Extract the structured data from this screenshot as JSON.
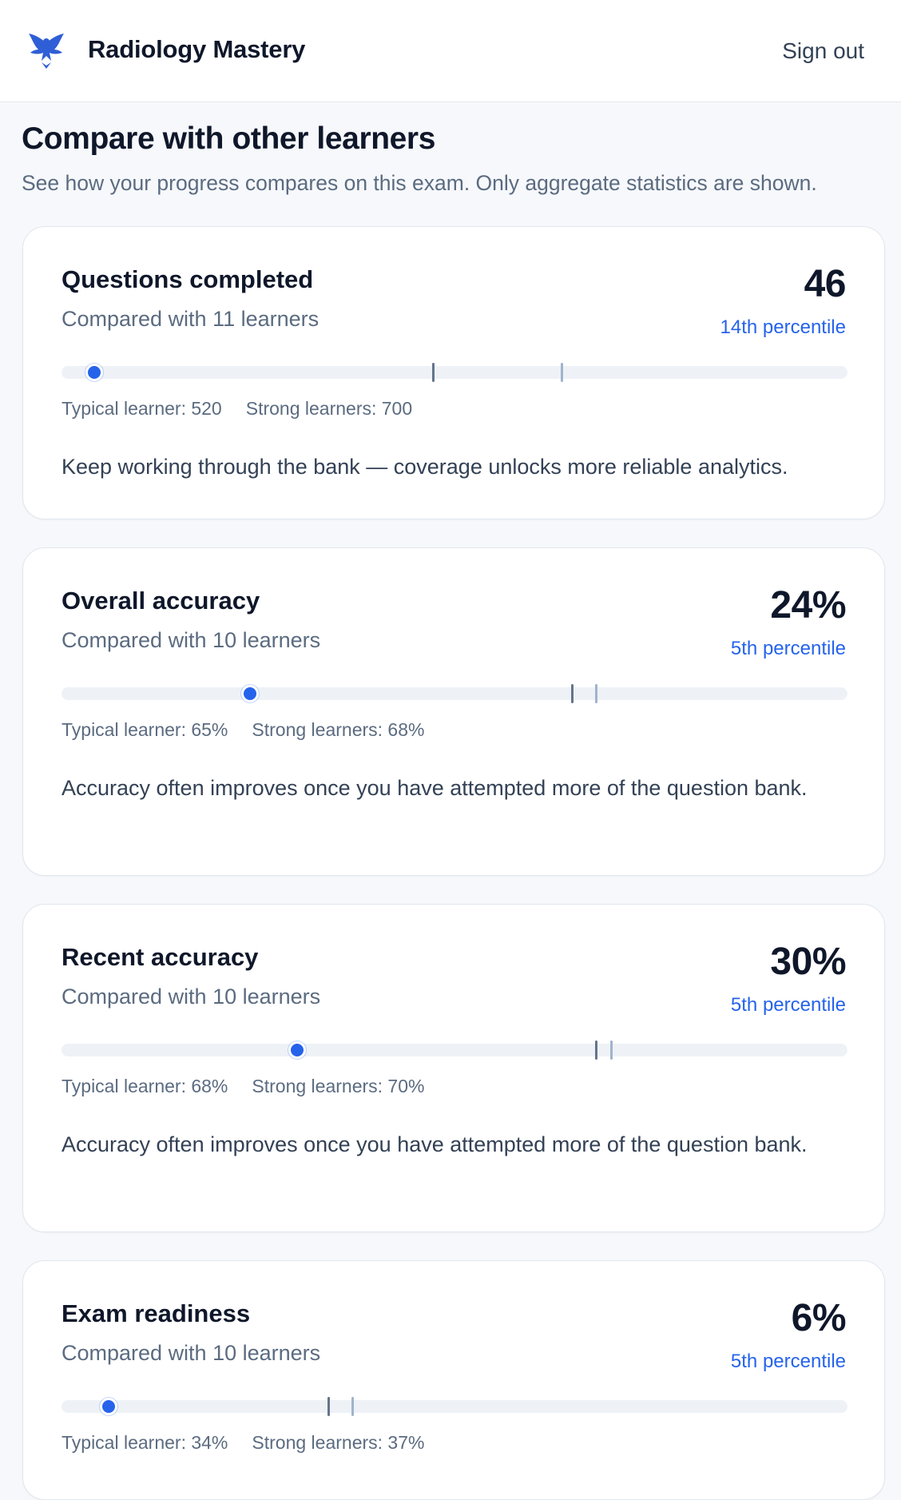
{
  "app": {
    "title": "Radiology Mastery",
    "sign_out": "Sign out",
    "logo_icon": "eagle-logo-icon",
    "accent": "#2563eb"
  },
  "page": {
    "title": "Compare with other learners",
    "subtitle": "See how your progress compares on this exam. Only aggregate statistics are shown."
  },
  "cards": [
    {
      "title": "Questions completed",
      "compared": "Compared with 11 learners",
      "value": "46",
      "percentile": "14th percentile",
      "typical_label": "Typical learner: 520",
      "strong_label": "Strong learners: 700",
      "message": "Keep working through the bank — coverage unlocks more reliable analytics.",
      "scale_max": 1100,
      "you": 46,
      "typical": 520,
      "strong": 700
    },
    {
      "title": "Overall accuracy",
      "compared": "Compared with 10 learners",
      "value": "24%",
      "percentile": "5th percentile",
      "typical_label": "Typical learner: 65%",
      "strong_label": "Strong learners: 68%",
      "message": "Accuracy often improves once you have attempted more of the question bank.",
      "scale_max": 100,
      "you": 24,
      "typical": 65,
      "strong": 68
    },
    {
      "title": "Recent accuracy",
      "compared": "Compared with 10 learners",
      "value": "30%",
      "percentile": "5th percentile",
      "typical_label": "Typical learner: 68%",
      "strong_label": "Strong learners: 70%",
      "message": "Accuracy often improves once you have attempted more of the question bank.",
      "scale_max": 100,
      "you": 30,
      "typical": 68,
      "strong": 70
    },
    {
      "title": "Exam readiness",
      "compared": "Compared with 10 learners",
      "value": "6%",
      "percentile": "5th percentile",
      "typical_label": "Typical learner: 34%",
      "strong_label": "Strong learners: 37%",
      "message": "",
      "scale_max": 100,
      "you": 6,
      "typical": 34,
      "strong": 37
    }
  ]
}
